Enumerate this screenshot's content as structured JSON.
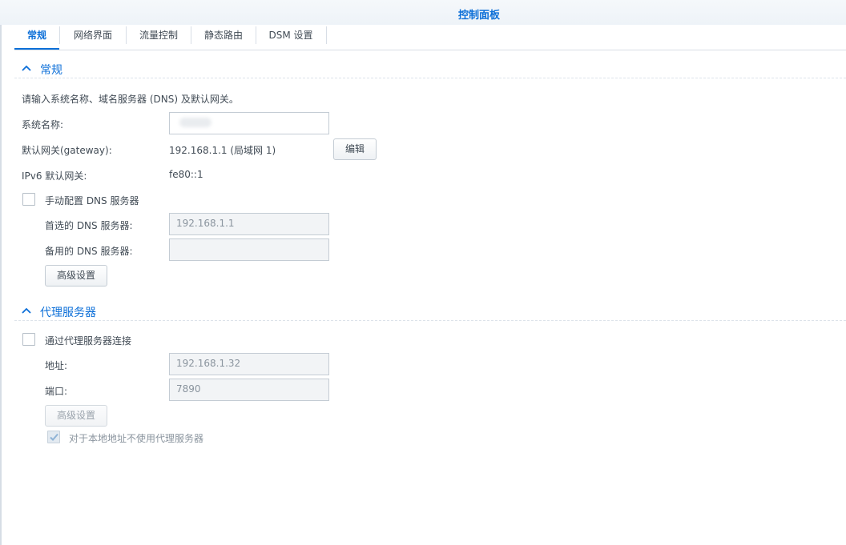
{
  "window": {
    "title": "控制面板"
  },
  "tabs": [
    {
      "label": "常规",
      "active": true
    },
    {
      "label": "网络界面"
    },
    {
      "label": "流量控制"
    },
    {
      "label": "静态路由"
    },
    {
      "label": "DSM 设置"
    }
  ],
  "general": {
    "section_title": "常规",
    "description": "请输入系统名称、域名服务器 (DNS) 及默认网关。",
    "system_name_label": "系统名称:",
    "system_name_value": "",
    "gateway_label": "默认网关(gateway):",
    "gateway_value": "192.168.1.1 (局域网 1)",
    "edit_button": "编辑",
    "ipv6_gateway_label": "IPv6 默认网关:",
    "ipv6_gateway_value": "fe80::1",
    "manual_dns_label": "手动配置 DNS 服务器",
    "manual_dns_checked": false,
    "preferred_dns_label": "首选的 DNS 服务器:",
    "preferred_dns_value": "192.168.1.1",
    "alternate_dns_label": "备用的 DNS 服务器:",
    "alternate_dns_value": "",
    "advanced_button": "高级设置"
  },
  "proxy": {
    "section_title": "代理服务器",
    "connect_via_proxy_label": "通过代理服务器连接",
    "connect_via_proxy_checked": false,
    "address_label": "地址:",
    "address_value": "192.168.1.32",
    "port_label": "端口:",
    "port_value": "7890",
    "advanced_button": "高级设置",
    "bypass_local_label": "对于本地地址不使用代理服务器",
    "bypass_local_checked": true
  },
  "colors": {
    "accent": "#0c6fd8",
    "text": "#414b55",
    "border": "#c4ccd4"
  }
}
